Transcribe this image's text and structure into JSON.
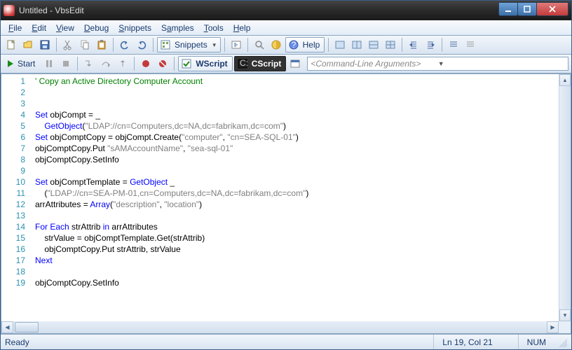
{
  "window": {
    "title": "Untitled - VbsEdit"
  },
  "menu": {
    "file": "File",
    "edit": "Edit",
    "view": "View",
    "debug": "Debug",
    "snippets": "Snippets",
    "samples": "Samples",
    "tools": "Tools",
    "help": "Help"
  },
  "toolbar1": {
    "snippets_label": "Snippets",
    "help_label": "Help"
  },
  "toolbar2": {
    "start_label": "Start",
    "wscript_label": "WScript",
    "cscript_label": "CScript",
    "cmd_placeholder": "<Command-Line Arguments>"
  },
  "code": {
    "lines": [
      {
        "n": 1,
        "tokens": [
          [
            "comment",
            "' Copy an Active Directory Computer Account"
          ]
        ]
      },
      {
        "n": 2,
        "tokens": []
      },
      {
        "n": 3,
        "tokens": []
      },
      {
        "n": 4,
        "tokens": [
          [
            "keyword",
            "Set"
          ],
          [
            "ident",
            " objCompt = _"
          ]
        ]
      },
      {
        "n": 5,
        "tokens": [
          [
            "ident",
            "    "
          ],
          [
            "keyword",
            "GetObject"
          ],
          [
            "ident",
            "("
          ],
          [
            "string",
            "\"LDAP://cn=Computers,dc=NA,dc=fabrikam,dc=com\""
          ],
          [
            "ident",
            ")"
          ]
        ]
      },
      {
        "n": 6,
        "tokens": [
          [
            "keyword",
            "Set"
          ],
          [
            "ident",
            " objComptCopy = objCompt.Create("
          ],
          [
            "string",
            "\"computer\""
          ],
          [
            "ident",
            ", "
          ],
          [
            "string",
            "\"cn=SEA-SQL-01\""
          ],
          [
            "ident",
            ")"
          ]
        ]
      },
      {
        "n": 7,
        "tokens": [
          [
            "ident",
            "objComptCopy.Put "
          ],
          [
            "string",
            "\"sAMAccountName\""
          ],
          [
            "ident",
            ", "
          ],
          [
            "string",
            "\"sea-sql-01\""
          ]
        ]
      },
      {
        "n": 8,
        "tokens": [
          [
            "ident",
            "objComptCopy.SetInfo"
          ]
        ]
      },
      {
        "n": 9,
        "tokens": []
      },
      {
        "n": 10,
        "tokens": [
          [
            "keyword",
            "Set"
          ],
          [
            "ident",
            " objComptTemplate = "
          ],
          [
            "keyword",
            "GetObject"
          ],
          [
            "ident",
            " _"
          ]
        ]
      },
      {
        "n": 11,
        "tokens": [
          [
            "ident",
            "    ("
          ],
          [
            "string",
            "\"LDAP://cn=SEA-PM-01,cn=Computers,dc=NA,dc=fabrikam,dc=com\""
          ],
          [
            "ident",
            ")"
          ]
        ]
      },
      {
        "n": 12,
        "tokens": [
          [
            "ident",
            "arrAttributes = "
          ],
          [
            "keyword",
            "Array"
          ],
          [
            "ident",
            "("
          ],
          [
            "string",
            "\"description\""
          ],
          [
            "ident",
            ", "
          ],
          [
            "string",
            "\"location\""
          ],
          [
            "ident",
            ")"
          ]
        ]
      },
      {
        "n": 13,
        "tokens": []
      },
      {
        "n": 14,
        "tokens": [
          [
            "keyword",
            "For"
          ],
          [
            "ident",
            " "
          ],
          [
            "keyword",
            "Each"
          ],
          [
            "ident",
            " strAttrib "
          ],
          [
            "keyword",
            "in"
          ],
          [
            "ident",
            " arrAttributes"
          ]
        ]
      },
      {
        "n": 15,
        "tokens": [
          [
            "ident",
            "    strValue = objComptTemplate.Get(strAttrib)"
          ]
        ]
      },
      {
        "n": 16,
        "tokens": [
          [
            "ident",
            "    objComptCopy.Put strAttrib, strValue"
          ]
        ]
      },
      {
        "n": 17,
        "tokens": [
          [
            "keyword",
            "Next"
          ]
        ]
      },
      {
        "n": 18,
        "tokens": []
      },
      {
        "n": 19,
        "tokens": [
          [
            "ident",
            "objComptCopy.SetInfo"
          ]
        ]
      }
    ]
  },
  "status": {
    "ready": "Ready",
    "cursor": "Ln 19, Col 21",
    "num": "NUM"
  }
}
